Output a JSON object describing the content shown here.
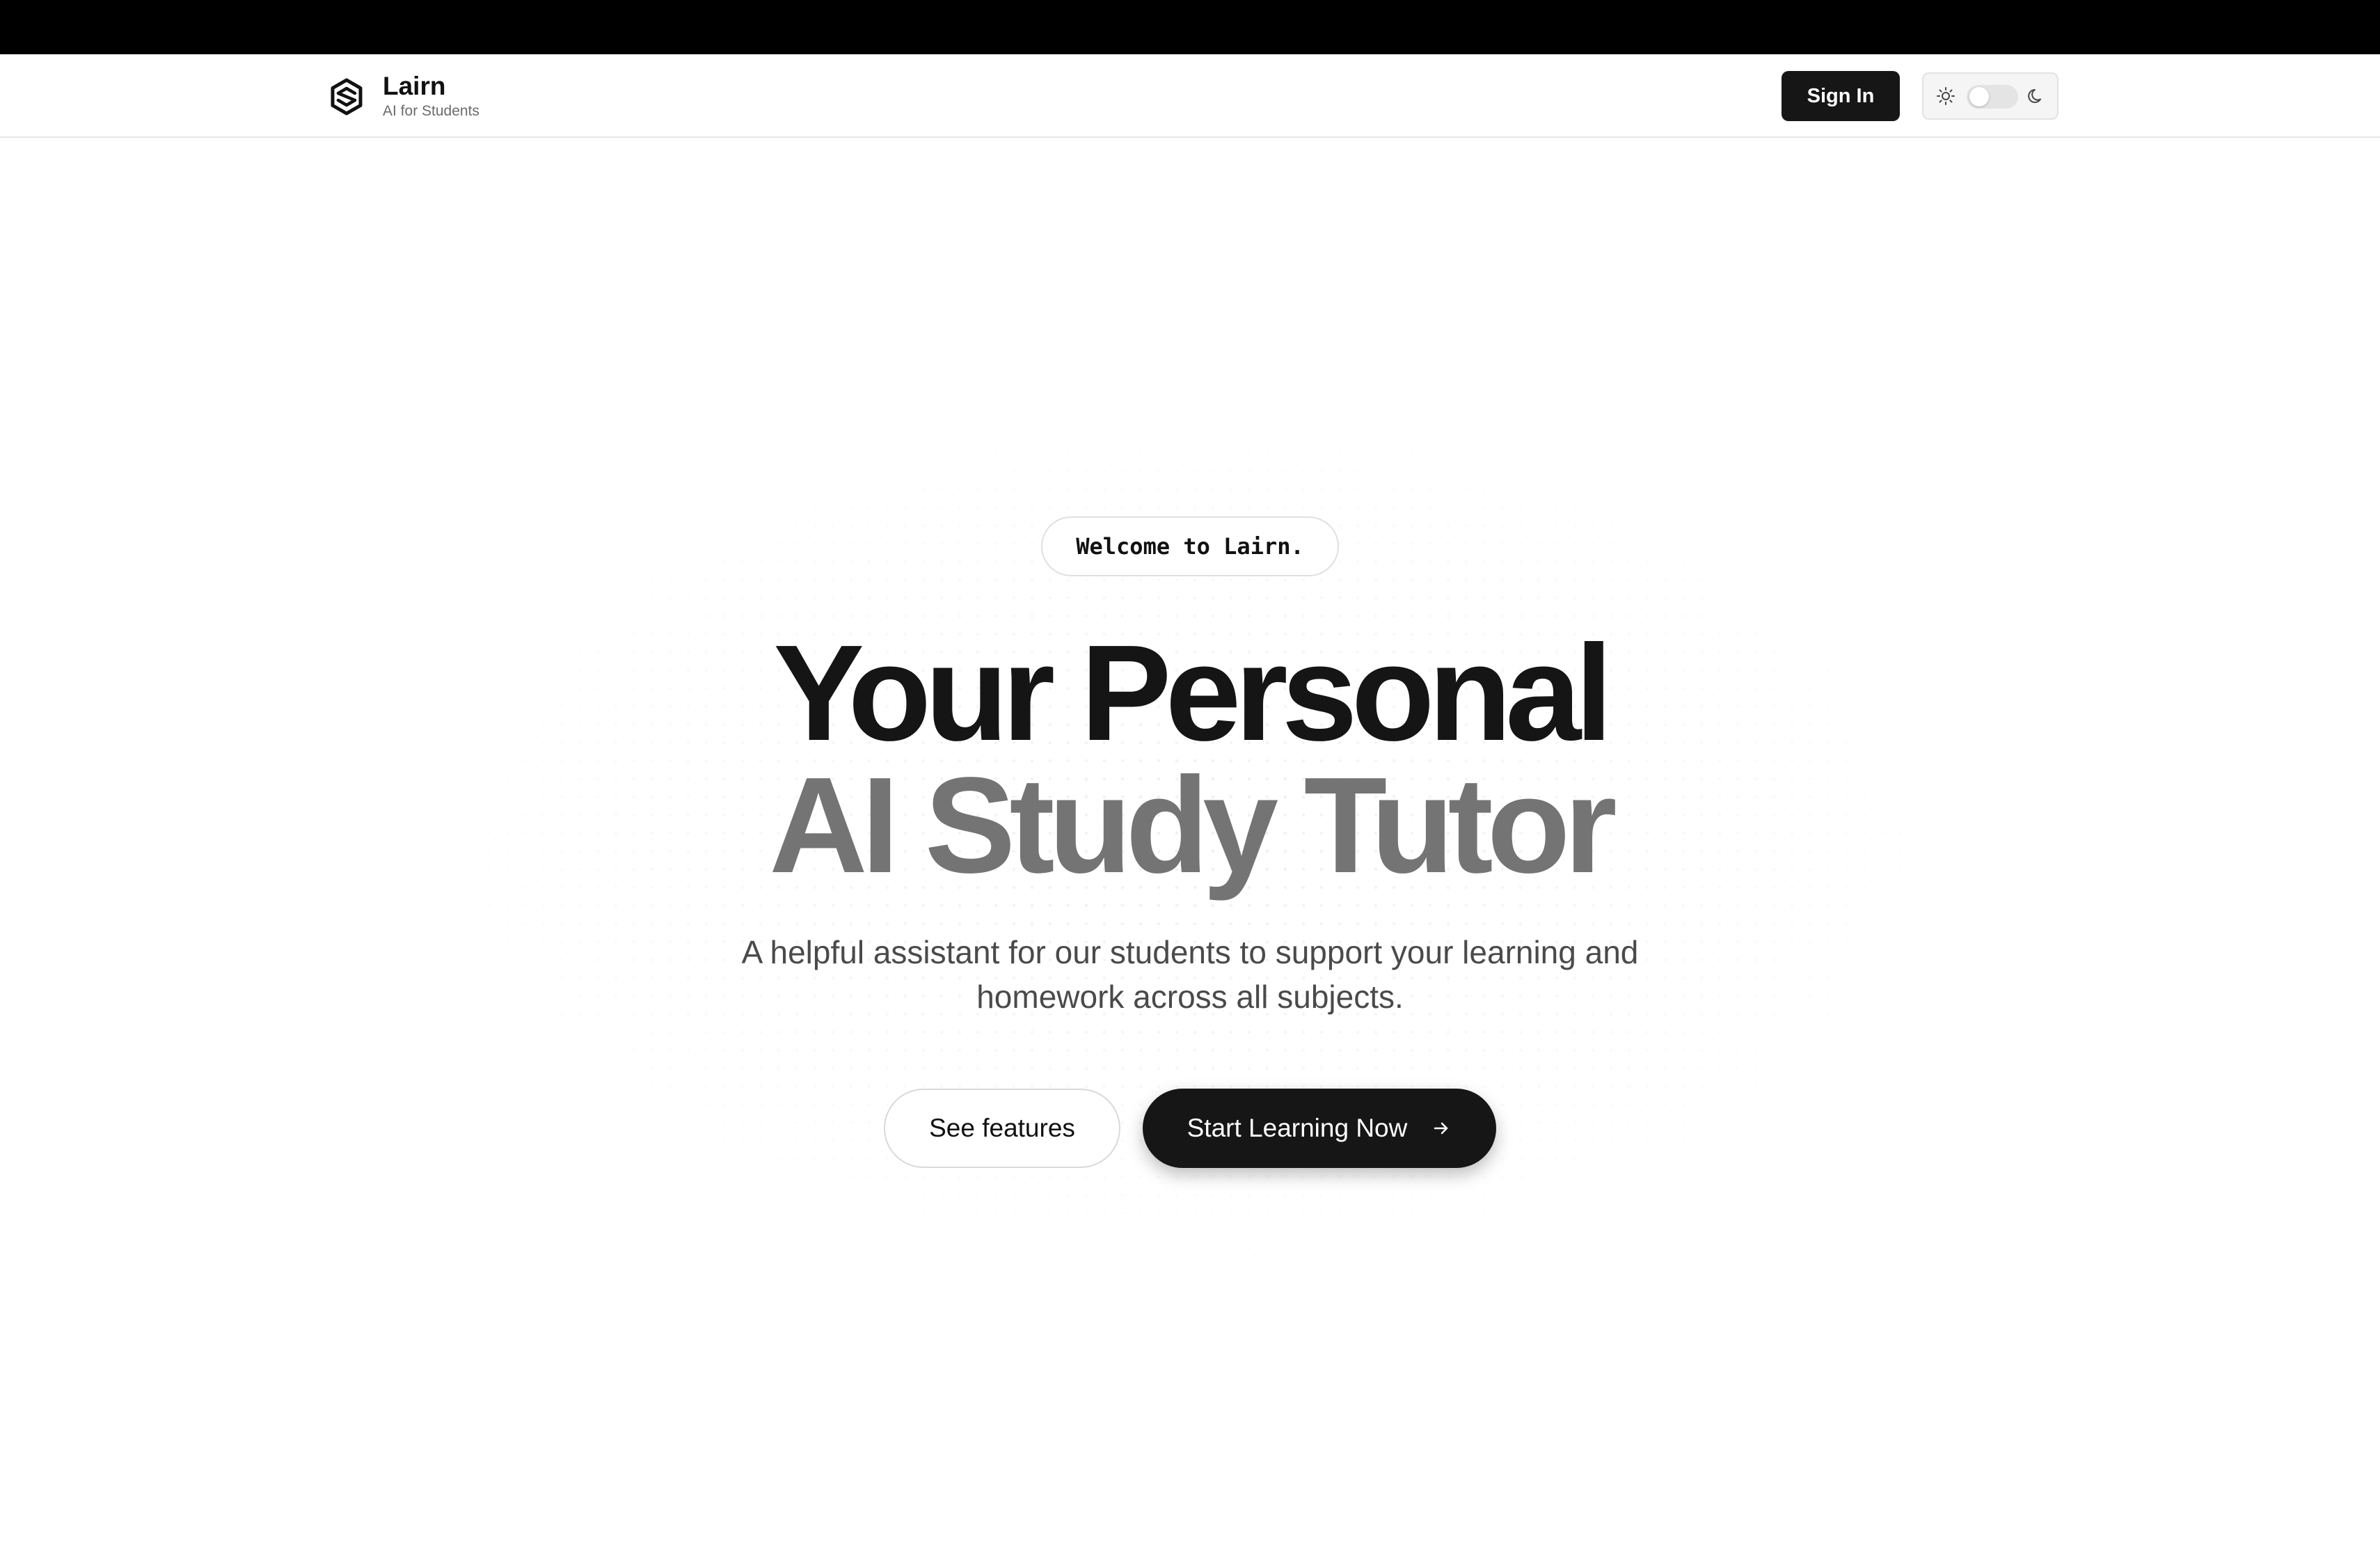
{
  "header": {
    "brand_name": "Lairn",
    "brand_subtitle": "AI for Students",
    "sign_in_label": "Sign In",
    "theme_toggle": {
      "state": "light"
    }
  },
  "hero": {
    "welcome_pill": "Welcome to Lairn.",
    "headline_line1": "Your Personal",
    "headline_line2": "AI Study Tutor",
    "subtitle_line1": "A helpful assistant for our students to support your learning and",
    "subtitle_line2": "homework across all subjects.",
    "see_features_label": "See features",
    "start_learning_label": "Start Learning Now"
  },
  "icons": {
    "logo": "hexagon-logo-icon",
    "sun": "sun-icon",
    "moon": "moon-icon",
    "arrow": "arrow-right-icon"
  },
  "colors": {
    "primary_dark": "#161616",
    "headline_secondary": "#747474",
    "background": "#ffffff",
    "top_bar": "#000000"
  }
}
